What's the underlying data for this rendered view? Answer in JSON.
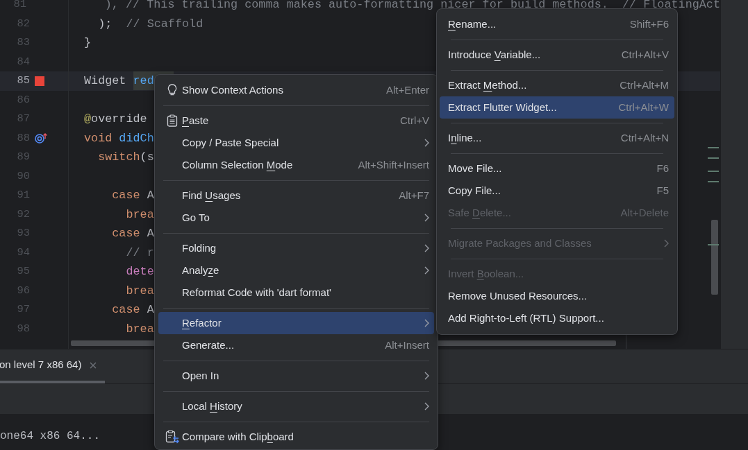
{
  "editor": {
    "lines": [
      {
        "number": "81",
        "current": false,
        "tokens": [
          {
            "text": "    ), // This trailing comma makes auto-formatting nicer for build methods.  // FloatingAct",
            "kind": "comment"
          }
        ]
      },
      {
        "number": "82",
        "current": false,
        "tokens": [
          {
            "text": "  );  ",
            "kind": "plain"
          },
          {
            "text": "// Scaffold",
            "kind": "comment"
          }
        ]
      },
      {
        "number": "83",
        "current": false,
        "tokens": [
          {
            "text": "}",
            "kind": "plain"
          }
        ]
      },
      {
        "number": "84",
        "current": false
      },
      {
        "number": "85",
        "current": true,
        "tokens": [
          {
            "text": "Widget ",
            "kind": "plain"
          },
          {
            "text": "red",
            "kind": "usage"
          }
        ]
      },
      {
        "number": "86",
        "current": false
      },
      {
        "number": "87",
        "current": false,
        "tokens": [
          {
            "text": "@",
            "kind": "annotation"
          },
          {
            "text": "override",
            "kind": "plain"
          }
        ]
      },
      {
        "number": "88",
        "current": false,
        "tokens": [
          {
            "text": "void ",
            "kind": "keyword"
          },
          {
            "text": "didCh",
            "kind": "method"
          }
        ]
      },
      {
        "number": "89",
        "current": false,
        "tokens": [
          {
            "text": "  switch",
            "kind": "keyword"
          },
          {
            "text": "(s",
            "kind": "plain"
          }
        ]
      },
      {
        "number": "90",
        "current": false
      },
      {
        "number": "91",
        "current": false,
        "tokens": [
          {
            "text": "    case ",
            "kind": "keyword"
          },
          {
            "text": "A",
            "kind": "plain"
          }
        ]
      },
      {
        "number": "92",
        "current": false,
        "tokens": [
          {
            "text": "      brea",
            "kind": "keyword"
          }
        ]
      },
      {
        "number": "93",
        "current": false,
        "tokens": [
          {
            "text": "    case ",
            "kind": "keyword"
          },
          {
            "text": "A",
            "kind": "plain"
          }
        ]
      },
      {
        "number": "94",
        "current": false,
        "tokens": [
          {
            "text": "      // r",
            "kind": "comment"
          }
        ]
      },
      {
        "number": "95",
        "current": false,
        "tokens": [
          {
            "text": "      dete",
            "kind": "field"
          }
        ]
      },
      {
        "number": "96",
        "current": false,
        "tokens": [
          {
            "text": "      brea",
            "kind": "keyword"
          }
        ]
      },
      {
        "number": "97",
        "current": false,
        "tokens": [
          {
            "text": "    case ",
            "kind": "keyword"
          },
          {
            "text": "A",
            "kind": "plain"
          }
        ]
      },
      {
        "number": "98",
        "current": false,
        "tokens": [
          {
            "text": "      brea",
            "kind": "keyword"
          }
        ]
      }
    ]
  },
  "context_menu": {
    "items": [
      {
        "kind": "item",
        "label": "Show Context Actions",
        "shortcut": "Alt+Enter",
        "submenu": false,
        "selected": false
      },
      {
        "kind": "separator"
      },
      {
        "kind": "item",
        "label": [
          {
            "text": "P",
            "mnemonic": true
          },
          {
            "text": "aste",
            "mnemonic": false
          }
        ],
        "shortcut": "Ctrl+V",
        "submenu": false,
        "selected": false
      },
      {
        "kind": "item",
        "label": "Copy / Paste Special",
        "submenu": true,
        "selected": false
      },
      {
        "kind": "item",
        "label": [
          {
            "text": "Column Selection ",
            "mnemonic": false
          },
          {
            "text": "M",
            "mnemonic": true
          },
          {
            "text": "ode",
            "mnemonic": false
          }
        ],
        "shortcut": "Alt+Shift+Insert",
        "submenu": false,
        "selected": false
      },
      {
        "kind": "separator"
      },
      {
        "kind": "item",
        "label": [
          {
            "text": "Find ",
            "mnemonic": false
          },
          {
            "text": "U",
            "mnemonic": true
          },
          {
            "text": "sages",
            "mnemonic": false
          }
        ],
        "shortcut": "Alt+F7",
        "submenu": false,
        "selected": false
      },
      {
        "kind": "item",
        "label": "Go To",
        "submenu": true,
        "selected": false
      },
      {
        "kind": "separator"
      },
      {
        "kind": "item",
        "label": "Folding",
        "submenu": true,
        "selected": false
      },
      {
        "kind": "item",
        "label": [
          {
            "text": "Analy",
            "mnemonic": false
          },
          {
            "text": "z",
            "mnemonic": true
          },
          {
            "text": "e",
            "mnemonic": false
          }
        ],
        "submenu": true,
        "selected": false
      },
      {
        "kind": "item",
        "label": "Reformat Code with 'dart format'",
        "submenu": false,
        "selected": false
      },
      {
        "kind": "separator"
      },
      {
        "kind": "item",
        "label": [
          {
            "text": "R",
            "mnemonic": true
          },
          {
            "text": "efactor",
            "mnemonic": false
          }
        ],
        "submenu": true,
        "selected": true
      },
      {
        "kind": "item",
        "label": "Generate...",
        "shortcut": "Alt+Insert",
        "submenu": false,
        "selected": false
      },
      {
        "kind": "separator"
      },
      {
        "kind": "item",
        "label": "Open In",
        "submenu": true,
        "selected": false
      },
      {
        "kind": "separator"
      },
      {
        "kind": "item",
        "label": [
          {
            "text": "Local ",
            "mnemonic": false
          },
          {
            "text": "H",
            "mnemonic": true
          },
          {
            "text": "istory",
            "mnemonic": false
          }
        ],
        "submenu": true,
        "selected": false
      },
      {
        "kind": "separator"
      },
      {
        "kind": "item",
        "label": [
          {
            "text": "Compare with Clip",
            "mnemonic": false
          },
          {
            "text": "b",
            "mnemonic": true
          },
          {
            "text": "oard",
            "mnemonic": false
          }
        ],
        "submenu": false,
        "selected": false
      }
    ]
  },
  "refactor_menu": {
    "items": [
      {
        "kind": "item",
        "label": [
          {
            "text": "R",
            "mnemonic": true
          },
          {
            "text": "ename...",
            "mnemonic": false
          }
        ],
        "shortcut": "Shift+F6",
        "submenu": false,
        "disabled": false,
        "selected": false
      },
      {
        "kind": "separator"
      },
      {
        "kind": "item",
        "label": [
          {
            "text": "Introduce ",
            "mnemonic": false
          },
          {
            "text": "V",
            "mnemonic": true
          },
          {
            "text": "ariable...",
            "mnemonic": false
          }
        ],
        "shortcut": "Ctrl+Alt+V",
        "submenu": false,
        "disabled": false,
        "selected": false
      },
      {
        "kind": "separator"
      },
      {
        "kind": "item",
        "label": [
          {
            "text": "Extract ",
            "mnemonic": false
          },
          {
            "text": "M",
            "mnemonic": true
          },
          {
            "text": "ethod...",
            "mnemonic": false
          }
        ],
        "shortcut": "Ctrl+Alt+M",
        "submenu": false,
        "disabled": false,
        "selected": false
      },
      {
        "kind": "item",
        "label": "Extract Flutter Widget...",
        "shortcut": "Ctrl+Alt+W",
        "submenu": false,
        "disabled": false,
        "selected": true
      },
      {
        "kind": "separator"
      },
      {
        "kind": "item",
        "label": [
          {
            "text": "I",
            "mnemonic": false
          },
          {
            "text": "n",
            "mnemonic": true
          },
          {
            "text": "line...",
            "mnemonic": false
          }
        ],
        "shortcut": "Ctrl+Alt+N",
        "submenu": false,
        "disabled": false,
        "selected": false
      },
      {
        "kind": "separator"
      },
      {
        "kind": "item",
        "label": "Move File...",
        "shortcut": "F6",
        "submenu": false,
        "disabled": false,
        "selected": false
      },
      {
        "kind": "item",
        "label": "Copy File...",
        "shortcut": "F5",
        "submenu": false,
        "disabled": false,
        "selected": false
      },
      {
        "kind": "item",
        "label": [
          {
            "text": "Safe ",
            "mnemonic": false
          },
          {
            "text": "D",
            "mnemonic": true
          },
          {
            "text": "elete...",
            "mnemonic": false
          }
        ],
        "shortcut": "Alt+Delete",
        "submenu": false,
        "disabled": true,
        "selected": false
      },
      {
        "kind": "separator"
      },
      {
        "kind": "item",
        "label": "Migrate Packages and Classes",
        "submenu": true,
        "disabled": true,
        "selected": false
      },
      {
        "kind": "separator"
      },
      {
        "kind": "item",
        "label": [
          {
            "text": "Invert ",
            "mnemonic": false
          },
          {
            "text": "B",
            "mnemonic": true
          },
          {
            "text": "oolean...",
            "mnemonic": false
          }
        ],
        "submenu": false,
        "disabled": true,
        "selected": false
      },
      {
        "kind": "item",
        "label": "Remove Unused Resources...",
        "submenu": false,
        "disabled": false,
        "selected": false
      },
      {
        "kind": "item",
        "label": "Add Right-to-Left (RTL) Support...",
        "submenu": false,
        "disabled": false,
        "selected": false
      }
    ]
  },
  "bottom_panel": {
    "tab": {
      "label": "on level 7 x86 64)",
      "selected": true
    },
    "console": [
      "one64 x86 64..."
    ]
  }
}
